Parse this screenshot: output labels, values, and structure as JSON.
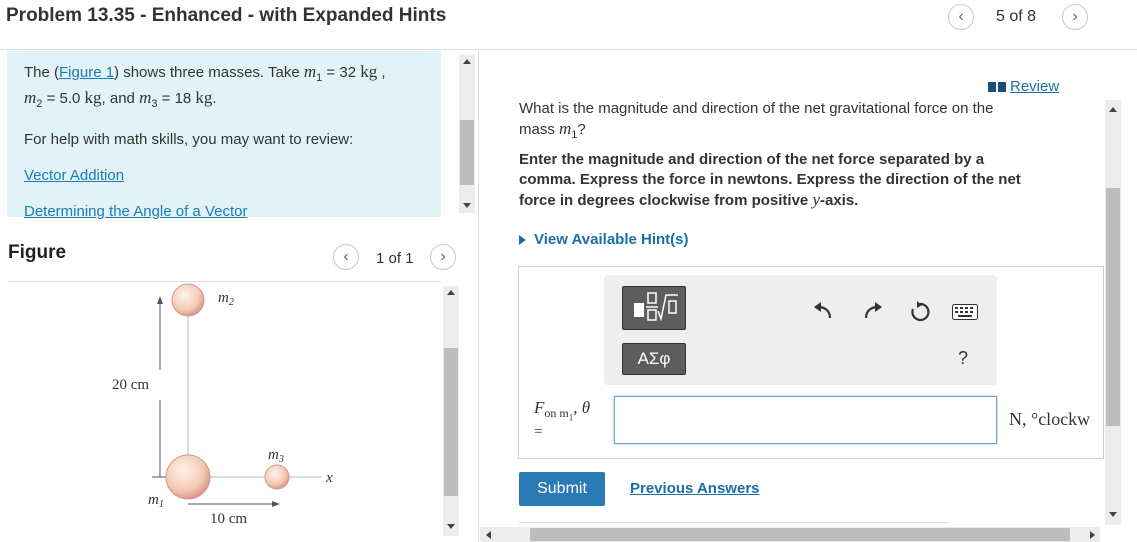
{
  "header": {
    "title": "Problem 13.35 - Enhanced - with Expanded Hints",
    "nav_count": "5 of 8"
  },
  "intro": {
    "text_prefix": "The (",
    "figure_link": "Figure 1",
    "text_suffix": ") shows three masses. Take ",
    "m1_sym": "m",
    "m1_sub": "1",
    "m1_eq": " = 32 ",
    "m1_unit": "kg",
    "comma1": " ,",
    "m2_sym": "m",
    "m2_sub": "2",
    "m2_eq": " = 5.0 ",
    "m2_unit": "kg",
    "and_text": ", and ",
    "m3_sym": "m",
    "m3_sub": "3",
    "m3_eq": " = 18 ",
    "m3_unit": "kg",
    "period": ".",
    "help_text": "For help with math skills, you may want to review:",
    "links": [
      "Vector Addition",
      "Determining the Angle of a Vector"
    ]
  },
  "figure": {
    "label": "Figure",
    "page_count": "1 of 1",
    "m2_label": "m",
    "m2_sub": "2",
    "m3_label": "m",
    "m3_sub": "3",
    "m1_label": "m",
    "m1_sub": "1",
    "vertical_dim": "20 cm",
    "horizontal_dim": "10 cm",
    "axis_x": "x"
  },
  "review": {
    "label": "Review"
  },
  "question": {
    "text": "What is the magnitude and direction of the net gravitational force on the mass ",
    "sym": "m",
    "sub": "1",
    "end": "?",
    "instructions": "Enter the magnitude and direction of the net force separated by a comma. Express the force in newtons. Express the direction of the net force in degrees clockwise from positive ",
    "axis": "y",
    "axis_suffix": "-axis.",
    "hints_label": "View Available Hint(s)"
  },
  "answer": {
    "f_sym": "F",
    "f_sub": "on m",
    "f_subsub": "1",
    "f_theta": ", θ",
    "equals": "=",
    "greek_button": "ΑΣφ",
    "help_button": "?",
    "input_value": "",
    "units": "N, °clockw",
    "submit": "Submit",
    "previous": "Previous Answers"
  }
}
